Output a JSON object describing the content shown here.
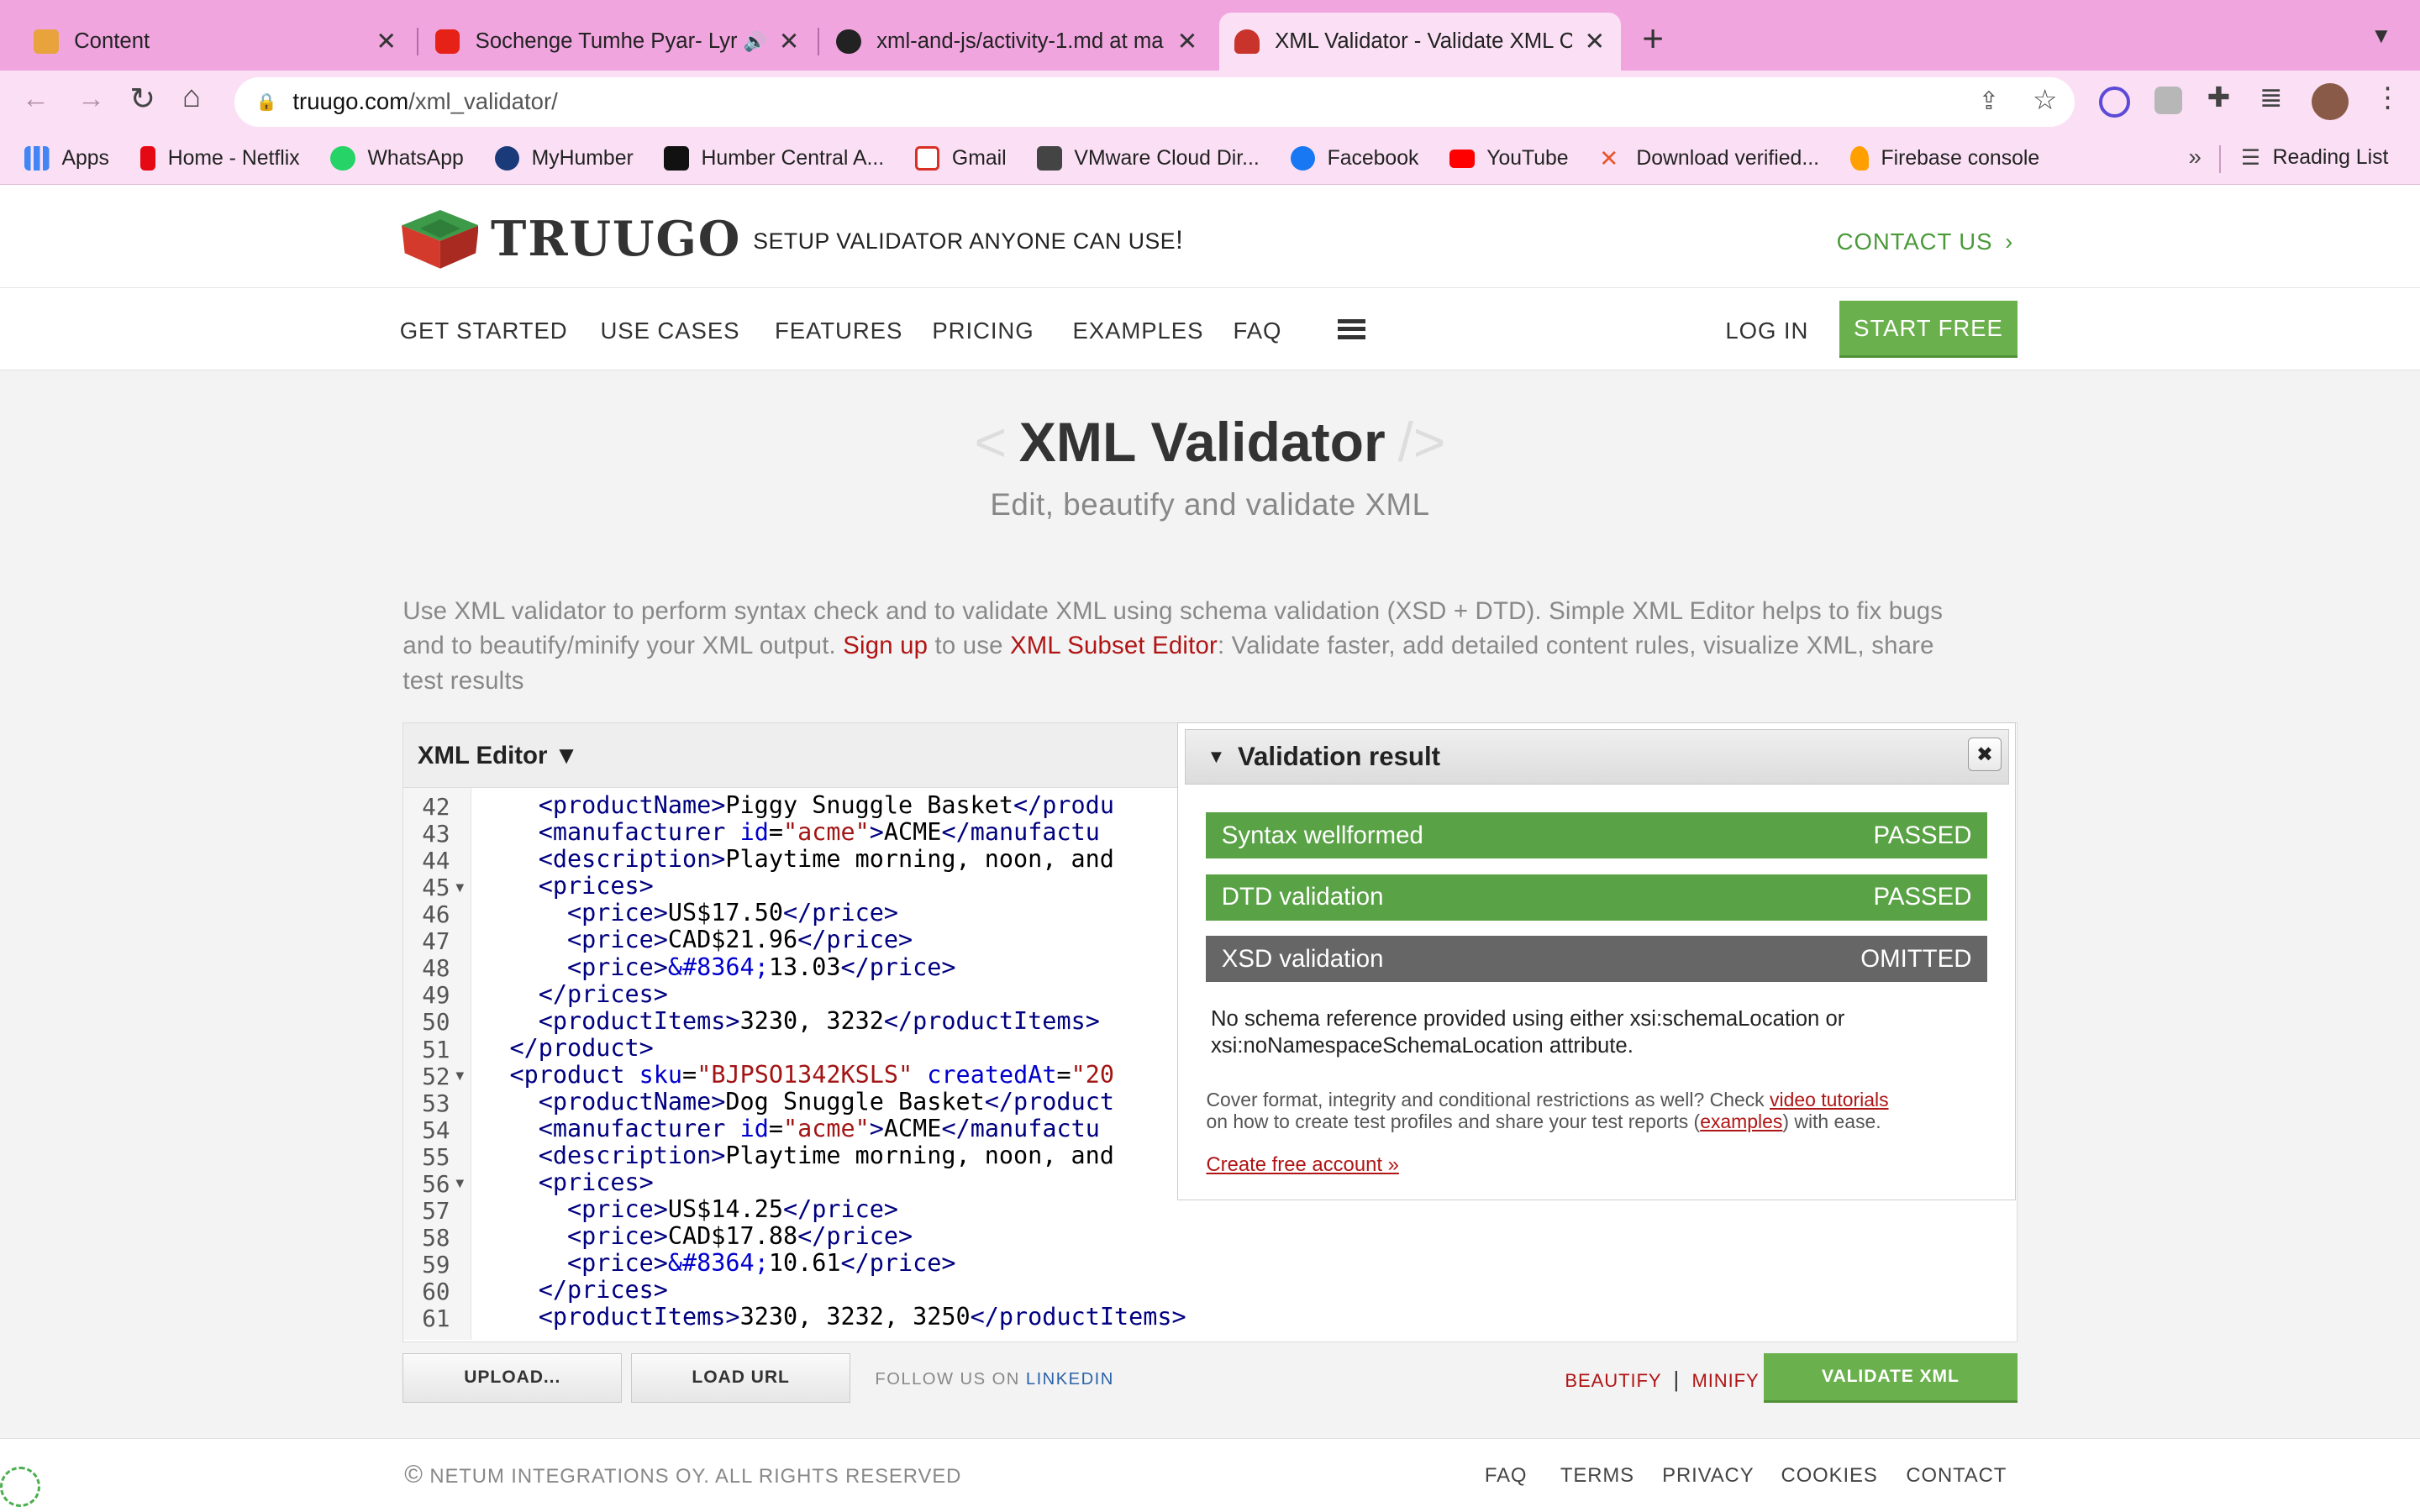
{
  "browser": {
    "tabs": [
      {
        "title": "Content",
        "color": "#e8a33d"
      },
      {
        "title": "Sochenge Tumhe Pyar- Lyr",
        "color": "#e62117",
        "audio": "🔊"
      },
      {
        "title": "xml-and-js/activity-1.md at ma",
        "color": "#222222"
      },
      {
        "title": "XML Validator - Validate XML C",
        "color": "#c8342b"
      }
    ],
    "new_tab": "+",
    "url_host": "truugo.com",
    "url_path": "/xml_validator/",
    "bookmarks": [
      {
        "label": "Apps",
        "color": "#4285f4"
      },
      {
        "label": "Home - Netflix",
        "color": "#e50914"
      },
      {
        "label": "WhatsApp",
        "color": "#25d366"
      },
      {
        "label": "MyHumber",
        "color": "#1b3a7a"
      },
      {
        "label": "Humber Central A...",
        "color": "#111111"
      },
      {
        "label": "Gmail",
        "color": "#d93025"
      },
      {
        "label": "VMware Cloud Dir...",
        "color": "#444444"
      },
      {
        "label": "Facebook",
        "color": "#1877f2"
      },
      {
        "label": "YouTube",
        "color": "#ff0000"
      },
      {
        "label": "Download verified...",
        "color": "#e8542b"
      },
      {
        "label": "Firebase console",
        "color": "#ffa000"
      }
    ],
    "more": "»",
    "reading_list": "Reading List"
  },
  "site": {
    "logo_text": "TRUUGO",
    "tagline": "SETUP VALIDATOR ANYONE CAN USE",
    "tagline_mark": "!",
    "contact": "CONTACT US",
    "nav": [
      "GET STARTED",
      "USE CASES",
      "FEATURES",
      "PRICING",
      "EXAMPLES",
      "FAQ"
    ],
    "login": "LOG IN",
    "start_free": "START FREE"
  },
  "hero": {
    "open": "<",
    "title": "XML Validator",
    "close": "/>",
    "subtitle": "Edit, beautify and validate XML"
  },
  "intro": {
    "text1": "Use XML validator to perform syntax check and to validate XML using schema validation (XSD + DTD). Simple XML Editor helps to fix bugs",
    "text2a": "and to beautify/minify your XML output. ",
    "signup": "Sign up",
    "text2b": " to use ",
    "subset": "XML Subset Editor",
    "text2c": ": Validate faster, add detailed content rules, visualize XML, share",
    "text3": "test results"
  },
  "editor": {
    "title": "XML Editor ▼",
    "lines": [
      {
        "n": "42",
        "fold": false
      },
      {
        "n": "43",
        "fold": false
      },
      {
        "n": "44",
        "fold": false
      },
      {
        "n": "45",
        "fold": true
      },
      {
        "n": "46",
        "fold": false
      },
      {
        "n": "47",
        "fold": false
      },
      {
        "n": "48",
        "fold": false
      },
      {
        "n": "49",
        "fold": false
      },
      {
        "n": "50",
        "fold": false
      },
      {
        "n": "51",
        "fold": false
      },
      {
        "n": "52",
        "fold": true
      },
      {
        "n": "53",
        "fold": false
      },
      {
        "n": "54",
        "fold": false
      },
      {
        "n": "55",
        "fold": false
      },
      {
        "n": "56",
        "fold": true
      },
      {
        "n": "57",
        "fold": false
      },
      {
        "n": "58",
        "fold": false
      },
      {
        "n": "59",
        "fold": false
      },
      {
        "n": "60",
        "fold": false
      },
      {
        "n": "61",
        "fold": false
      }
    ],
    "code": [
      [
        [
          "t",
          "    <productName>"
        ],
        [
          "k",
          "Piggy Snuggle Basket"
        ],
        [
          "t",
          "</produ"
        ]
      ],
      [
        [
          "t",
          "    <manufacturer "
        ],
        [
          "a",
          "id"
        ],
        [
          "k",
          "="
        ],
        [
          "v",
          "\"acme\""
        ],
        [
          "t",
          ">"
        ],
        [
          "k",
          "ACME"
        ],
        [
          "t",
          "</manufactu"
        ]
      ],
      [
        [
          "t",
          "    <description>"
        ],
        [
          "k",
          "Playtime morning, noon, and"
        ]
      ],
      [
        [
          "t",
          "    <prices>"
        ]
      ],
      [
        [
          "t",
          "      <price>"
        ],
        [
          "k",
          "US$17.50"
        ],
        [
          "t",
          "</price>"
        ]
      ],
      [
        [
          "t",
          "      <price>"
        ],
        [
          "k",
          "CAD$21.96"
        ],
        [
          "t",
          "</price>"
        ]
      ],
      [
        [
          "t",
          "      <price>"
        ],
        [
          "a",
          "&#8364;"
        ],
        [
          "k",
          "13.03"
        ],
        [
          "t",
          "</price>"
        ]
      ],
      [
        [
          "t",
          "    </prices>"
        ]
      ],
      [
        [
          "t",
          "    <productItems>"
        ],
        [
          "k",
          "3230, 3232"
        ],
        [
          "t",
          "</productItems>"
        ]
      ],
      [
        [
          "t",
          "  </product>"
        ]
      ],
      [
        [
          "t",
          "  <product "
        ],
        [
          "a",
          "sku"
        ],
        [
          "k",
          "="
        ],
        [
          "v",
          "\"BJPSO1342KSLS\""
        ],
        [
          "k",
          " "
        ],
        [
          "a",
          "createdAt"
        ],
        [
          "k",
          "="
        ],
        [
          "v",
          "\"20"
        ]
      ],
      [
        [
          "t",
          "    <productName>"
        ],
        [
          "k",
          "Dog Snuggle Basket"
        ],
        [
          "t",
          "</product"
        ]
      ],
      [
        [
          "t",
          "    <manufacturer "
        ],
        [
          "a",
          "id"
        ],
        [
          "k",
          "="
        ],
        [
          "v",
          "\"acme\""
        ],
        [
          "t",
          ">"
        ],
        [
          "k",
          "ACME"
        ],
        [
          "t",
          "</manufactu"
        ]
      ],
      [
        [
          "t",
          "    <description>"
        ],
        [
          "k",
          "Playtime morning, noon, and"
        ]
      ],
      [
        [
          "t",
          "    <prices>"
        ]
      ],
      [
        [
          "t",
          "      <price>"
        ],
        [
          "k",
          "US$14.25"
        ],
        [
          "t",
          "</price>"
        ]
      ],
      [
        [
          "t",
          "      <price>"
        ],
        [
          "k",
          "CAD$17.88"
        ],
        [
          "t",
          "</price>"
        ]
      ],
      [
        [
          "t",
          "      <price>"
        ],
        [
          "a",
          "&#8364;"
        ],
        [
          "k",
          "10.61"
        ],
        [
          "t",
          "</price>"
        ]
      ],
      [
        [
          "t",
          "    </prices>"
        ]
      ],
      [
        [
          "t",
          "    <productItems>"
        ],
        [
          "k",
          "3230, 3232, 3250"
        ],
        [
          "t",
          "</productItems>"
        ]
      ]
    ]
  },
  "validation": {
    "title": "Validation result",
    "results": [
      {
        "label": "Syntax wellformed",
        "status": "PASSED",
        "color": "#59a245"
      },
      {
        "label": "DTD validation",
        "status": "PASSED",
        "color": "#59a245"
      },
      {
        "label": "XSD validation",
        "status": "OMITTED",
        "color": "#666666"
      }
    ],
    "note1": "No schema reference provided using either xsi:schemaLocation or",
    "note2": "xsi:noNamespaceSchemaLocation attribute.",
    "cover1": "Cover format, integrity and conditional restrictions as well? Check ",
    "video": "video tutorials",
    "cover2": "on how to create test profiles and share your test reports (",
    "examples": "examples",
    "cover3": ") with ease.",
    "create": "Create free account »"
  },
  "actions": {
    "upload": "UPLOAD...",
    "load_url": "LOAD URL",
    "follow": "FOLLOW US ON",
    "linkedin": "LINKEDIN",
    "beautify": "BEAUTIFY",
    "divider": "|",
    "minify": "MINIFY",
    "validate": "VALIDATE XML"
  },
  "footer": {
    "copyright_symbol": "©",
    "copyright": "NETUM INTEGRATIONS OY. ALL RIGHTS RESERVED",
    "links": [
      "FAQ",
      "TERMS",
      "PRIVACY",
      "COOKIES",
      "CONTACT"
    ]
  },
  "colors": {
    "accent_green": "#6ab04c",
    "link_red": "#b01515",
    "brand_red": "#d33a2c"
  }
}
